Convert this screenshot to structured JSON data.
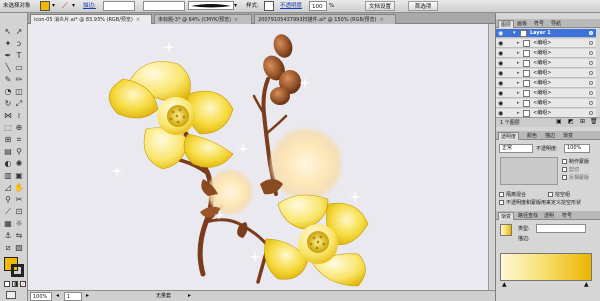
{
  "control_bar": {
    "selection_label": "未选择对象",
    "stroke_label": "描边:",
    "opacity_label": "不透明度",
    "style_label": "样式:",
    "opacity_value": "100",
    "percent": "%",
    "doc_setup_button": "文档设置",
    "prefs_button": "首选项",
    "fill_color": "#f0b800"
  },
  "document": {
    "tabs": [
      {
        "label": "icon-05 消炎片.ai* @ 83.93% (RGB/预览)",
        "close": "×"
      },
      {
        "label": "未标题-3* @ 64% (CMYK/预览)",
        "close": "×"
      },
      {
        "label": "20079105437993扫描件.ai* @ 150% (RGB/预览)",
        "close": "×"
      }
    ],
    "canvas_bg": "#e9e9ef"
  },
  "status_bar": {
    "zoom": "100%",
    "page": "1",
    "status_text": "无量套"
  },
  "layers_panel": {
    "tabs": [
      "图层",
      "画板",
      "符号",
      "导航"
    ],
    "layer_name": "Layer 1",
    "items": [
      "<编组>",
      "<编组>",
      "<编组>",
      "<编组>",
      "<编组>",
      "<编组>",
      "<编组>",
      "<编组>"
    ],
    "count_label": "1 个图层",
    "selected_color": "#3d72d8"
  },
  "transparency_panel": {
    "tabs": [
      "透明度",
      "颜色",
      "描边",
      "渐变"
    ],
    "blend_mode": "正常",
    "opacity_label": "不透明度:",
    "opacity_value": "100%",
    "make_mask": "制作蒙版",
    "clip": "剪切",
    "invert_mask": "反相蒙版"
  },
  "blend_options": {
    "isolate": "隔离混合",
    "knockout": "挖空组",
    "opacity_mask": "不透明度和蒙版用来定义挖空形状"
  },
  "swatch_panel": {
    "tabs": [
      "渐变",
      "路径查找",
      "透明",
      "符号"
    ],
    "type_label": "类型:",
    "stroke_label": "描边:",
    "gradient_colors": [
      "#fff7d8",
      "#f7df6a",
      "#e9b400"
    ]
  }
}
